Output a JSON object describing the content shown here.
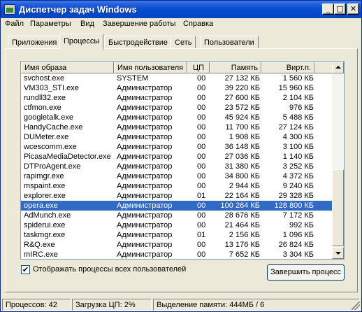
{
  "window": {
    "title": "Диспетчер задач Windows"
  },
  "menu": [
    "Файл",
    "Параметры",
    "Вид",
    "Завершение работы",
    "Справка"
  ],
  "tabs": [
    "Приложения",
    "Процессы",
    "Быстродействие",
    "Сеть",
    "Пользователи"
  ],
  "active_tab": "Процессы",
  "table": {
    "columns": [
      "Имя образа",
      "Имя пользователя",
      "ЦП",
      "Память",
      "Вирт.п."
    ],
    "rows": [
      {
        "name": "svchost.exe",
        "user": "SYSTEM",
        "cpu": "00",
        "mem": "27 132 КБ",
        "virt": "1 560 КБ"
      },
      {
        "name": "VM303_STI.exe",
        "user": "Администратор",
        "cpu": "00",
        "mem": "39 220 КБ",
        "virt": "15 960 КБ"
      },
      {
        "name": "rundll32.exe",
        "user": "Администратор",
        "cpu": "00",
        "mem": "27 600 КБ",
        "virt": "2 104 КБ"
      },
      {
        "name": "ctfmon.exe",
        "user": "Администратор",
        "cpu": "00",
        "mem": "23 572 КБ",
        "virt": "976 КБ"
      },
      {
        "name": "googletalk.exe",
        "user": "Администратор",
        "cpu": "00",
        "mem": "45 924 КБ",
        "virt": "5 488 КБ"
      },
      {
        "name": "HandyCache.exe",
        "user": "Администратор",
        "cpu": "00",
        "mem": "11 700 КБ",
        "virt": "27 124 КБ"
      },
      {
        "name": "DUMeter.exe",
        "user": "Администратор",
        "cpu": "00",
        "mem": "1 908 КБ",
        "virt": "4 300 КБ"
      },
      {
        "name": "wcescomm.exe",
        "user": "Администратор",
        "cpu": "00",
        "mem": "36 148 КБ",
        "virt": "3 100 КБ"
      },
      {
        "name": "PicasaMediaDetector.exe",
        "user": "Администратор",
        "cpu": "00",
        "mem": "27 036 КБ",
        "virt": "1 140 КБ"
      },
      {
        "name": "DTProAgent.exe",
        "user": "Администратор",
        "cpu": "00",
        "mem": "31 380 КБ",
        "virt": "3 252 КБ"
      },
      {
        "name": "rapimgr.exe",
        "user": "Администратор",
        "cpu": "00",
        "mem": "34 800 КБ",
        "virt": "4 372 КБ"
      },
      {
        "name": "mspaint.exe",
        "user": "Администратор",
        "cpu": "00",
        "mem": "2 944 КБ",
        "virt": "9 240 КБ"
      },
      {
        "name": "explorer.exe",
        "user": "Администратор",
        "cpu": "01",
        "mem": "22 164 КБ",
        "virt": "29 328 КБ"
      },
      {
        "name": "opera.exe",
        "user": "Администратор",
        "cpu": "00",
        "mem": "100 264 КБ",
        "virt": "128 800 КБ",
        "selected": true
      },
      {
        "name": "AdMunch.exe",
        "user": "Администратор",
        "cpu": "00",
        "mem": "28 676 КБ",
        "virt": "7 172 КБ"
      },
      {
        "name": "spiderui.exe",
        "user": "Администратор",
        "cpu": "00",
        "mem": "21 464 КБ",
        "virt": "992 КБ"
      },
      {
        "name": "taskmgr.exe",
        "user": "Администратор",
        "cpu": "01",
        "mem": "2 156 КБ",
        "virt": "1 096 КБ"
      },
      {
        "name": "R&Q.exe",
        "user": "Администратор",
        "cpu": "00",
        "mem": "13 176 КБ",
        "virt": "26 824 КБ"
      },
      {
        "name": "mIRC.exe",
        "user": "Администратор",
        "cpu": "00",
        "mem": "7 652 КБ",
        "virt": "3 304 КБ"
      }
    ]
  },
  "show_all_users": {
    "label": "Отображать процессы всех пользователей",
    "checked": true,
    "check_glyph": "✔"
  },
  "end_process_button": "Завершить процесс",
  "status": {
    "processes": "Процессов: 42",
    "cpu": "Загрузка ЦП: 2%",
    "memory": "Выделение памяти: 444МБ / 6"
  },
  "colors": {
    "selection": "#316ac5",
    "titlebar": "#0a4fd1",
    "face": "#ece9d8"
  },
  "icons": {
    "minimize": "minimize-icon",
    "maximize": "maximize-icon",
    "close": "close-icon",
    "app": "task-manager-icon"
  }
}
